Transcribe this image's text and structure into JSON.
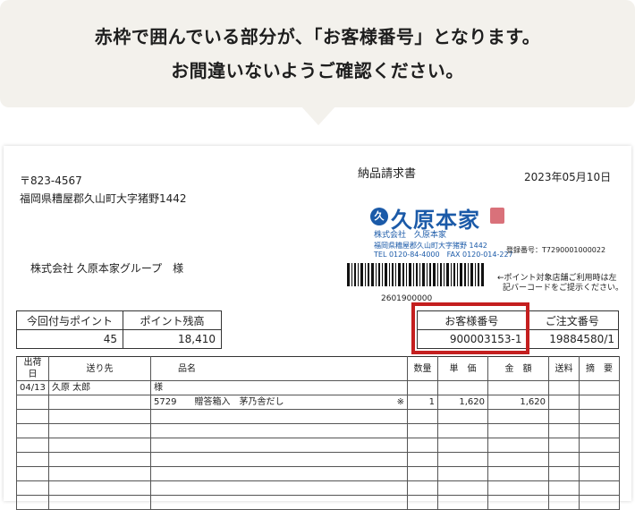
{
  "bubble": {
    "line1": "赤枠で囲んでいる部分が、「お客様番号」となります。",
    "line2": "お間違いないようご確認ください。"
  },
  "doc": {
    "postal": "〒823-4567",
    "address": "福岡県糟屋郡久山町大字猪野1442",
    "title": "納品請求書",
    "date": "2023年05月10日",
    "recipient": "株式会社 久原本家グループ　様",
    "logo_mark": "久",
    "logo_name": "久原本家",
    "company_line": "株式会社　久原本家",
    "company_address": "福岡県糟屋郡久山町大字猪野 1442",
    "tel_fax": "TEL 0120-84-4000　FAX 0120-014-227",
    "registration": "登録番号：T7290001000022",
    "barcode_number": "2601900000",
    "barcode_note1": "←ポイント対象店舗ご利用時は左",
    "barcode_note2": "記バーコードをご提示ください。",
    "points": {
      "granted_label": "今回付与ポイント",
      "granted_value": "45",
      "balance_label": "ポイント残高",
      "balance_value": "18,410"
    },
    "order": {
      "customer_label": "お客様番号",
      "customer_value": "900003153-1",
      "order_label": "ご注文番号",
      "order_value": "19884580/1"
    },
    "items": {
      "headers": {
        "ship_date": "出荷日",
        "destination": "送り先",
        "product": "品名",
        "quantity": "数量",
        "unit_price": "単　価",
        "amount": "金　額",
        "shipping": "送料",
        "remarks": "摘　要"
      },
      "row1": {
        "date": "04/13",
        "dest": "久原 太郎",
        "product": "様"
      },
      "row2": {
        "product": "5729　　贈答箱入　茅乃舎だし",
        "mark": "※",
        "quantity": "1",
        "unit_price": "1,620",
        "amount": "1,620"
      }
    }
  }
}
